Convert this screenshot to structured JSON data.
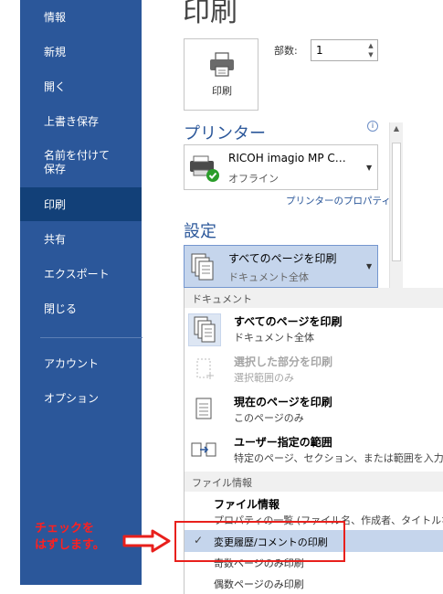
{
  "sidebar": {
    "items": [
      {
        "label": "情報"
      },
      {
        "label": "新規"
      },
      {
        "label": "開く"
      },
      {
        "label": "上書き保存"
      },
      {
        "label": "名前を付けて保存"
      },
      {
        "label": "印刷"
      },
      {
        "label": "共有"
      },
      {
        "label": "エクスポート"
      },
      {
        "label": "閉じる"
      },
      {
        "label": "アカウント"
      },
      {
        "label": "オプション"
      }
    ],
    "name_save_line1": "名前を付けて",
    "name_save_line2": "保存",
    "active": "印刷"
  },
  "main": {
    "title": "印刷",
    "print_button_label": "印刷",
    "copies_label": "部数:",
    "copies_value": "1",
    "printer_heading": "プリンター",
    "printer_name": "RICOH imagio MP C…",
    "printer_status": "オフライン",
    "printer_properties_link": "プリンターのプロパティ",
    "settings_heading": "設定",
    "settings_selected_title": "すべてのページを印刷",
    "settings_selected_sub": "ドキュメント全体"
  },
  "dropdown": {
    "section_document": "ドキュメント",
    "items": [
      {
        "title": "すべてのページを印刷",
        "sub": "ドキュメント全体",
        "icon": "pages-icon"
      },
      {
        "title": "選択した部分を印刷",
        "sub": "選択範囲のみ",
        "icon": "selection-icon"
      },
      {
        "title": "現在のページを印刷",
        "sub": "このページのみ",
        "icon": "page-icon"
      },
      {
        "title": "ユーザー指定の範囲",
        "sub": "特定のページ、セクション、または範囲を入力します",
        "icon": "custom-range-icon"
      }
    ],
    "section_file_info": "ファイル情報",
    "file_info_title": "ファイル情報",
    "file_info_sub": "プロパティの一覧 (ファイル名、作成者、タイトルなど)",
    "markup_label": "変更履歴/コメントの印刷",
    "markup_checked": true,
    "odd_pages": "奇数ページのみ印刷",
    "even_pages": "偶数ページのみ印刷"
  },
  "annotation": {
    "line1": "チェックを",
    "line2": "はずします。",
    "color": "#ff2020"
  },
  "colors": {
    "sidebar": "#2b579a",
    "sidebar_active": "#124078",
    "accent": "#2b579a",
    "highlight": "#c5d5ec"
  }
}
